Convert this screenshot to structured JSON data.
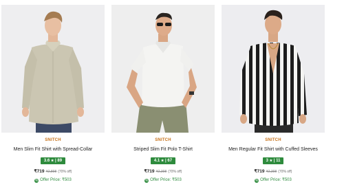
{
  "products": [
    {
      "brand": "SNITCH",
      "title": "Men Slim Fit Shirt with Spread-Collar",
      "rating": "3.6",
      "rating_count": "89",
      "price": "₹719",
      "mrp": "₹2,898",
      "discount": "(70% off)",
      "offer_price": "Offer Price: ₹503"
    },
    {
      "brand": "SNITCH",
      "title": "Striped Slim Fit Polo T-Shirt",
      "rating": "4.1",
      "rating_count": "67",
      "price": "₹719",
      "mrp": "₹2,398",
      "discount": "(70% off)",
      "offer_price": "Offer Price: ₹503"
    },
    {
      "brand": "SNITCH",
      "title": "Men Regular Fit Shirt with Cuffed Sleeves",
      "rating": "3",
      "rating_count": "11",
      "price": "₹719",
      "mrp": "₹2,398",
      "discount": "(70% off)",
      "offer_price": "Offer Price: ₹503"
    }
  ],
  "icons": {
    "rating_star": "★",
    "offer": "tag-icon"
  },
  "colors": {
    "brand": "#c7721b",
    "rating_badge": "#2e8b3d",
    "offer_text": "#2e8b3d"
  }
}
